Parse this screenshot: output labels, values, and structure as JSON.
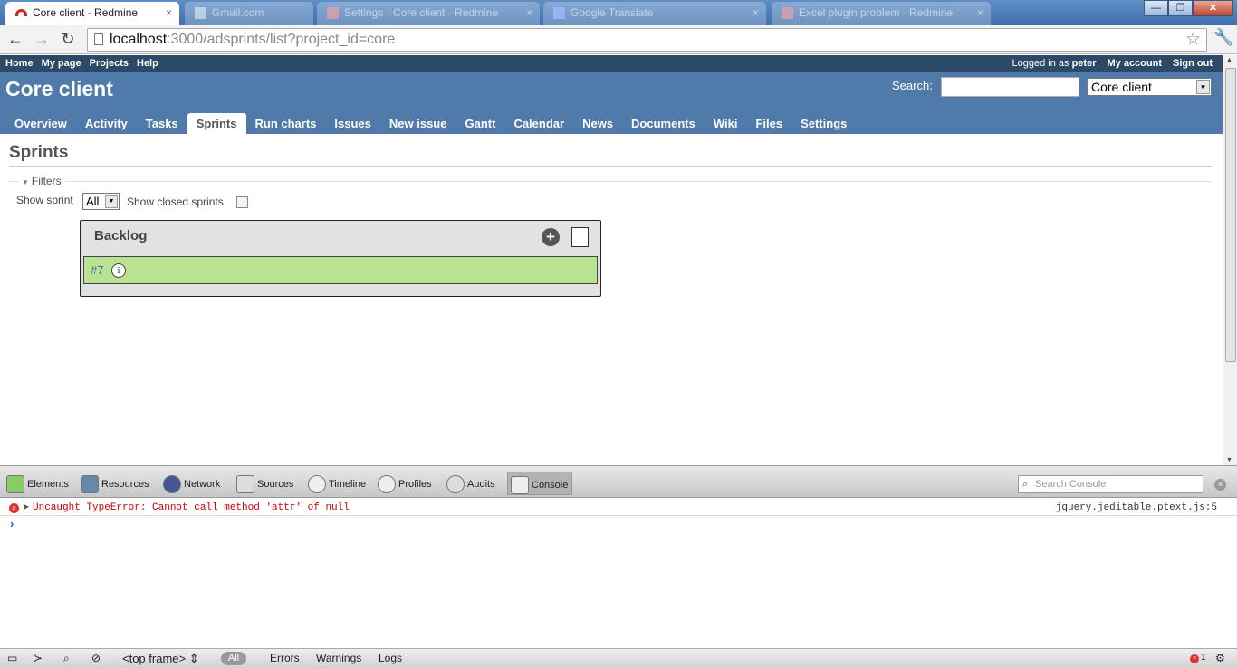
{
  "browser": {
    "tabs": [
      {
        "title": "Core client - Redmine",
        "close": "×"
      },
      {
        "title": "Gmail.com",
        "close": ""
      },
      {
        "title": "Settings - Core client - Redmine",
        "close": "×"
      },
      {
        "title": "Google Translate",
        "close": "×"
      },
      {
        "title": "Excel plugin problem - Redmine",
        "close": "×"
      }
    ],
    "window_controls": {
      "minimize": "—",
      "maximize": "❐",
      "close": "✕"
    },
    "nav": {
      "back": "←",
      "forward": "→",
      "reload": "↻"
    },
    "url_host": "localhost",
    "url_rest": ":3000/adsprints/list?project_id=core",
    "star": "☆",
    "wrench": "🔧"
  },
  "topmenu": {
    "left": [
      "Home",
      "My page",
      "Projects",
      "Help"
    ],
    "logged_in": "Logged in as",
    "user": "peter",
    "right": [
      "My account",
      "Sign out"
    ]
  },
  "header": {
    "title": "Core client",
    "search_label": "Search:",
    "search_value": "",
    "project_select": "Core client"
  },
  "mainmenu": [
    "Overview",
    "Activity",
    "Tasks",
    "Sprints",
    "Run charts",
    "Issues",
    "New issue",
    "Gantt",
    "Calendar",
    "News",
    "Documents",
    "Wiki",
    "Files",
    "Settings"
  ],
  "content": {
    "heading": "Sprints",
    "filters_label": "Filters",
    "show_sprint_label": "Show sprint",
    "show_sprint_value": "All",
    "show_closed_label": "Show closed sprints",
    "backlog_title": "Backlog",
    "add_icon": "+",
    "issue_number": "#7",
    "info_icon": "i"
  },
  "devtools": {
    "tabs": [
      "Elements",
      "Resources",
      "Network",
      "Sources",
      "Timeline",
      "Profiles",
      "Audits",
      "Console"
    ],
    "search_placeholder": "Search Console",
    "close": "×",
    "error_message": "Uncaught TypeError: Cannot call method 'attr' of null",
    "error_source": "jquery.jeditable.ptext.js:5",
    "prompt": "›",
    "bottom": {
      "frame": "<top frame>",
      "all": "All",
      "errors": "Errors",
      "warnings": "Warnings",
      "logs": "Logs",
      "error_count": "1"
    }
  },
  "colors": {
    "header_bg": "#507aaa",
    "topmenu_bg": "#2c4a68",
    "issue_bg": "#b9e292",
    "error_text": "#cc0000"
  }
}
